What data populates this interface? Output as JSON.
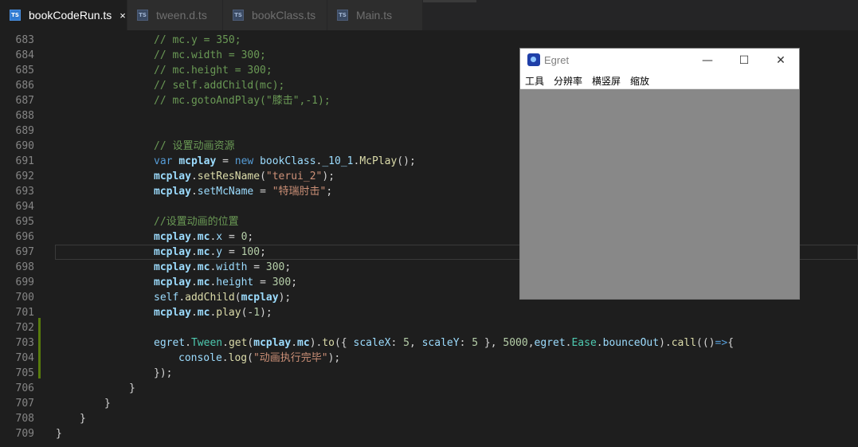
{
  "tabs": [
    {
      "label": "bookCodeRun.ts",
      "icon": "ts-file-icon",
      "close": "×"
    },
    {
      "label": "tween.d.ts",
      "icon": "ts-file-icon"
    },
    {
      "label": "bookClass.ts",
      "icon": "ts-file-icon"
    },
    {
      "label": "Main.ts",
      "icon": "ts-file-icon"
    }
  ],
  "icon_text": "TS",
  "lines": [
    {
      "n": "683",
      "code": "// mc.y = 350;"
    },
    {
      "n": "684",
      "code": "// mc.width = 300;"
    },
    {
      "n": "685",
      "code": "// mc.height = 300;"
    },
    {
      "n": "686",
      "code": "// self.addChild(mc);"
    },
    {
      "n": "687",
      "code": "// mc.gotoAndPlay(\"膝击\",-1);"
    },
    {
      "n": "688",
      "code": ""
    },
    {
      "n": "689",
      "code": ""
    },
    {
      "n": "690",
      "code": "// 设置动画资源"
    },
    {
      "n": "691",
      "code": "var mcplay = new bookClass._10_1.McPlay();"
    },
    {
      "n": "692",
      "code": "mcplay.setResName(\"terui_2\");"
    },
    {
      "n": "693",
      "code": "mcplay.setMcName = \"特瑞肘击\";"
    },
    {
      "n": "694",
      "code": ""
    },
    {
      "n": "695",
      "code": "//设置动画的位置"
    },
    {
      "n": "696",
      "code": "mcplay.mc.x = 0;"
    },
    {
      "n": "697",
      "code": "mcplay.mc.y = 100;"
    },
    {
      "n": "698",
      "code": "mcplay.mc.width = 300;"
    },
    {
      "n": "699",
      "code": "mcplay.mc.height = 300;"
    },
    {
      "n": "700",
      "code": "self.addChild(mcplay);"
    },
    {
      "n": "701",
      "code": "mcplay.mc.play(-1);"
    },
    {
      "n": "702",
      "code": ""
    },
    {
      "n": "703",
      "code": "egret.Tween.get(mcplay.mc).to({ scaleX: 5, scaleY: 5 }, 5000,egret.Ease.bounceOut).call(()=>{"
    },
    {
      "n": "704",
      "code": "console.log(\"动画执行完毕\");"
    },
    {
      "n": "705",
      "code": "});"
    },
    {
      "n": "706",
      "code": "}"
    },
    {
      "n": "707",
      "code": "}"
    },
    {
      "n": "708",
      "code": "}"
    },
    {
      "n": "709",
      "code": "}"
    }
  ],
  "window": {
    "title": "Egret",
    "minimize": "—",
    "maximize": "☐",
    "close": "✕",
    "menu": [
      "工具",
      "分辨率",
      "横竖屏",
      "缩放"
    ]
  },
  "colors": {
    "editor_bg": "#1e1e1e",
    "comment": "#6a9955",
    "keyword": "#569cd6",
    "variable": "#9cdcfe",
    "function": "#dcdcaa",
    "string": "#ce9178",
    "number": "#b5cea8",
    "canvas": "#888888"
  }
}
